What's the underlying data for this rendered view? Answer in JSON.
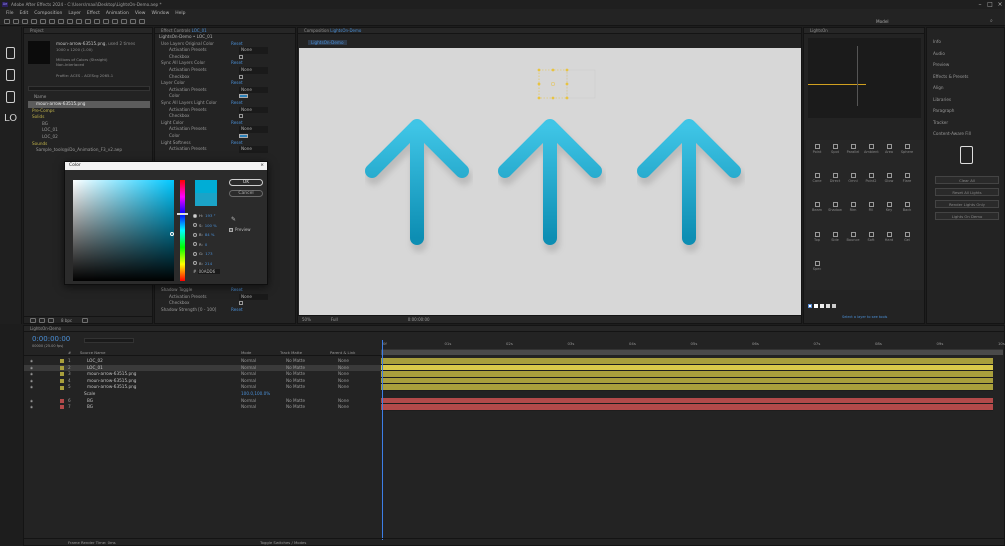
{
  "titlebar": {
    "app_title": "Adobe After Effects 2024 - C:\\Users\\maxi\\Desktop\\LightsOn-Demo.aep *"
  },
  "menu": [
    "File",
    "Edit",
    "Composition",
    "Layer",
    "Effect",
    "Animation",
    "View",
    "Window",
    "Help"
  ],
  "workspace_label": "Model",
  "project": {
    "tab": "Project",
    "selected_name": "moun-arrow-63515.png",
    "used_label": ", used 2 times",
    "dims": "1000 x 1200 (1.00)",
    "colors": "Millions of Colors (Straight)",
    "interpret": "Non-Interlaced",
    "profile": "Profile: ACES - ACEScg 2065-1",
    "name_header": "Name",
    "items": [
      "moun-arrow-63515.png",
      "Pre-Comps",
      "Solids",
      "BG",
      "LOC_01",
      "LOC_02",
      "Sounds",
      "Sample_tools@iDo_Animation_F3_v2.aep"
    ],
    "bpc": "8 bpc"
  },
  "tools_left": [
    "LO"
  ],
  "effects": {
    "tab": "Effect Controls",
    "layer": "LOC_01",
    "header": "LightsOn-Demo • LOC_01",
    "rows": [
      {
        "label": "Use Layers Original Color",
        "val": "Reset"
      },
      {
        "label": "Activation Presets",
        "val": "None"
      },
      {
        "label": "Checkbox",
        "val": ""
      },
      {
        "label": "Sync All Layers Color",
        "val": "Reset"
      },
      {
        "label": "Activation Presets",
        "val": "None"
      },
      {
        "label": "Checkbox",
        "val": ""
      },
      {
        "label": "Layer Color",
        "val": "Reset"
      },
      {
        "label": "Activation Presets",
        "val": "None"
      },
      {
        "label": "Color",
        "val": ""
      },
      {
        "label": "Sync All Layers Light Color",
        "val": "Reset"
      },
      {
        "label": "Activation Presets",
        "val": "None"
      },
      {
        "label": "Checkbox",
        "val": ""
      },
      {
        "label": "Light Color",
        "val": "Reset"
      },
      {
        "label": "Activation Presets",
        "val": "None"
      },
      {
        "label": "Color",
        "val": ""
      },
      {
        "label": "Light Softness",
        "val": "Reset"
      },
      {
        "label": "Activation Presets",
        "val": "None"
      }
    ],
    "bottom_rows": [
      {
        "label": "Shadow Toggle",
        "val": "Reset"
      },
      {
        "label": "Activation Presets",
        "val": "None"
      },
      {
        "label": "Checkbox",
        "val": ""
      },
      {
        "label": "Shadow Strength [0 - 100]",
        "val": "Reset"
      }
    ]
  },
  "color_dialog": {
    "title": "Color",
    "ok": "OK",
    "cancel": "Cancel",
    "fields": [
      {
        "label": "H:",
        "value": "193 °"
      },
      {
        "label": "S:",
        "value": "100 %"
      },
      {
        "label": "B:",
        "value": "84 %"
      },
      {
        "label": "R:",
        "value": "0"
      },
      {
        "label": "G:",
        "value": "173"
      },
      {
        "label": "B:",
        "value": "214"
      }
    ],
    "preview_label": "Preview",
    "hex_prefix": "#",
    "hex": "00ADD6",
    "color": "#00add6"
  },
  "composition": {
    "tab": "Composition",
    "comp_name": "LightsOn-Demo",
    "breadcrumb": "LightsOn-Demo",
    "zoom": "50%",
    "quality": "Full",
    "timecode": "0:00:00:00"
  },
  "right_panel": {
    "tab": "LightsOn",
    "icon_labels": [
      "Point",
      "Spot",
      "Parallel",
      "Ambient",
      "Area",
      "Sphere",
      "Cone",
      "Direct",
      "Omni",
      "Point2",
      "Glow",
      "Flare",
      "Beam",
      "Shadow",
      "Rim",
      "Fill",
      "Key",
      "Back",
      "Top",
      "Side",
      "Bounce",
      "Soft",
      "Hard",
      "Gel",
      "Spec"
    ],
    "status": "Select a layer to see tools",
    "far_right": [
      "Info",
      "Audio",
      "Preview",
      "Effects & Presets",
      "Align",
      "Libraries",
      "Paragraph",
      "Tracker",
      "Content-Aware Fill"
    ],
    "far_right_buttons": [
      "Clear All",
      "Reset All Lights",
      "Render Lights Only",
      "Lights On Demo"
    ]
  },
  "timeline": {
    "tab": "LightsOn-Demo",
    "timecode": "0:00:00:00",
    "fps_label": "00000 (25.00 fps)",
    "headers": {
      "num": "#",
      "source": "Source Name",
      "mode": "Mode",
      "trkmat": "Track Matte",
      "parent": "Parent & Link"
    },
    "layers": [
      {
        "num": "1",
        "name": "LOC_02",
        "mode": "Normal",
        "matte": "No Matte",
        "parent": "None",
        "color": "#a99f3c"
      },
      {
        "num": "2",
        "name": "LOC_01",
        "mode": "Normal",
        "matte": "No Matte",
        "parent": "None",
        "color": "#a99f3c"
      },
      {
        "num": "3",
        "name": "moun-arrow-63515.png",
        "mode": "Normal",
        "matte": "No Matte",
        "parent": "None",
        "color": "#a99f3c"
      },
      {
        "num": "4",
        "name": "moun-arrow-63515.png",
        "mode": "Normal",
        "matte": "No Matte",
        "parent": "None",
        "color": "#a99f3c"
      },
      {
        "num": "5",
        "name": "moun-arrow-63515.png",
        "mode": "Normal",
        "matte": "No Matte",
        "parent": "None",
        "color": "#a99f3c"
      },
      {
        "num": "",
        "name": "Scale",
        "mode": "100.0,100.0%",
        "matte": "",
        "parent": "",
        "color": ""
      },
      {
        "num": "6",
        "name": "BG",
        "mode": "Normal",
        "matte": "No Matte",
        "parent": "None",
        "color": "#b34a4a"
      },
      {
        "num": "7",
        "name": "BG",
        "mode": "Normal",
        "matte": "No Matte",
        "parent": "None",
        "color": "#b34a4a"
      }
    ],
    "ruler": [
      "0f",
      "01s",
      "02s",
      "03s",
      "04s",
      "05s",
      "06s",
      "07s",
      "08s",
      "09s",
      "10s"
    ],
    "bottom_left": "Frame Render Time:",
    "bottom_left_val": "0ms",
    "bottom_mid": "Toggle Switches / Modes"
  }
}
